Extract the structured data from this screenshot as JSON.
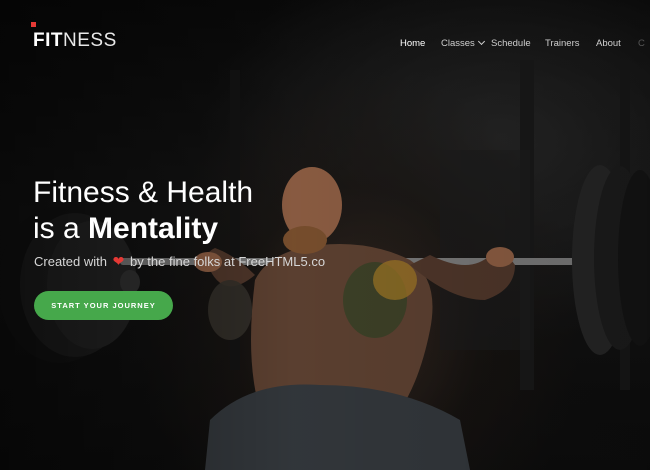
{
  "brand": {
    "name_bold": "FIT",
    "name_light": "NESS"
  },
  "nav": {
    "items": [
      {
        "label": "Home"
      },
      {
        "label": "Classes"
      },
      {
        "label": "Schedule"
      },
      {
        "label": "Trainers"
      },
      {
        "label": "About"
      },
      {
        "label": "C"
      }
    ]
  },
  "hero": {
    "headline_line1": "Fitness & Health",
    "headline_line2_prefix": "is a ",
    "headline_line2_emphasis": "Mentality",
    "tagline_prefix": "Created with",
    "tagline_heart": "❤",
    "tagline_suffix": "by the fine folks at FreeHTML5.co",
    "cta_label": "START YOUR JOURNEY"
  },
  "colors": {
    "accent": "#e53935",
    "cta": "#46a84b"
  },
  "icons": {
    "heart": "heart-icon",
    "dropdown": "chevron-down-icon"
  }
}
